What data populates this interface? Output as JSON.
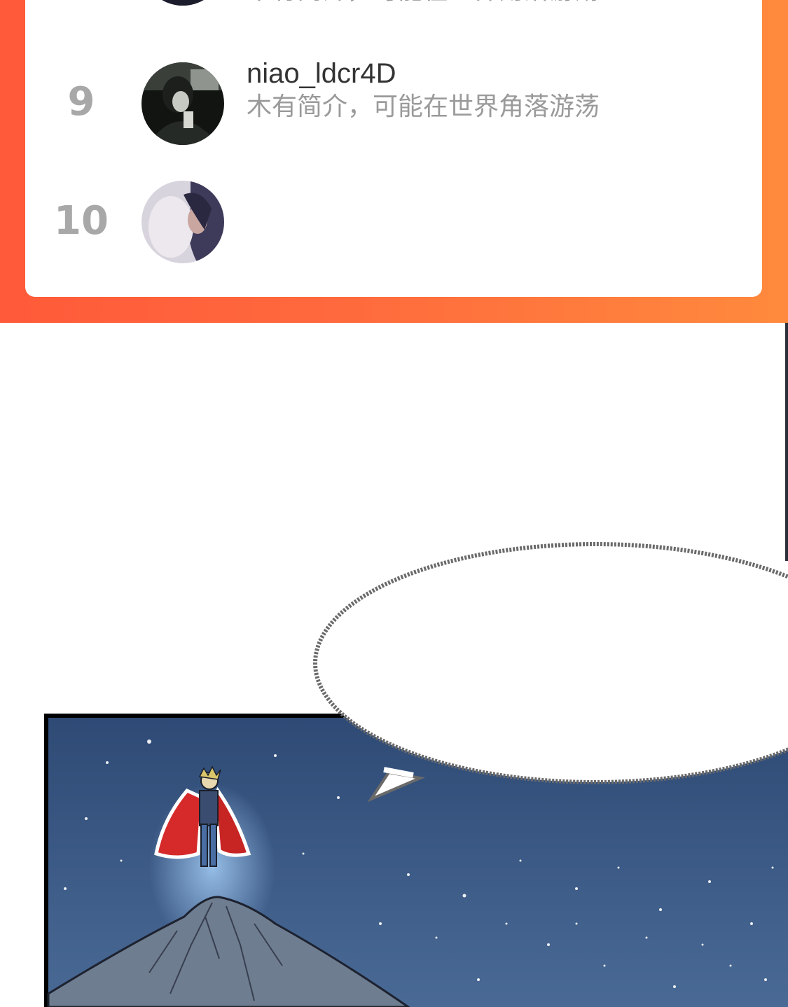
{
  "ranking": {
    "rows": [
      {
        "rank": "",
        "name": "",
        "bio": "木有简介，可能在世界角落游荡"
      },
      {
        "rank": "9",
        "name": "niao_ldcr4D",
        "bio": "木有简介，可能在世界角落游荡"
      },
      {
        "rank": "10",
        "name": "",
        "bio": ""
      }
    ]
  },
  "colors": {
    "banner_start": "#ff5a3a",
    "banner_end": "#ff8a3d",
    "rank_number": "#a8a8a8",
    "name_text": "#333333",
    "bio_text": "#9a9a9a",
    "night_sky": "#3f5d87"
  },
  "comic": {
    "speech_bubble_text": ""
  }
}
